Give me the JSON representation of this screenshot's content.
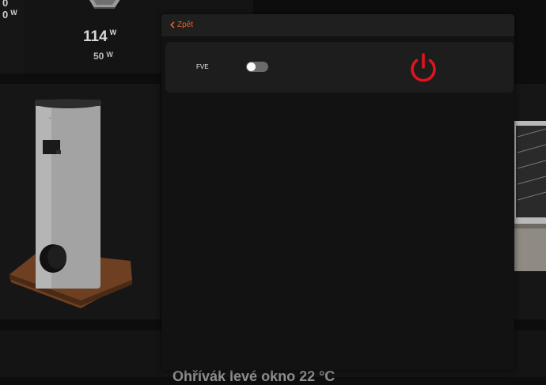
{
  "background": {
    "top_left_values": [
      "0",
      "0"
    ],
    "top_left_unit": "W",
    "power_main": "114",
    "power_main_unit": "W",
    "power_sub": "50",
    "power_sub_unit": "W",
    "bottom_label": "Ohřívák levé okno   22 °C"
  },
  "modal": {
    "back_label": "Zpět",
    "fve_label": "FVE",
    "fve_toggle_on": false,
    "power_state": "off"
  },
  "colors": {
    "accent": "#e0632a",
    "power_icon": "#e0141e",
    "modal_bg": "#121212",
    "card_bg": "#1d1d1d"
  },
  "icons": {
    "back": "chevron-left-icon",
    "power": "power-icon"
  }
}
